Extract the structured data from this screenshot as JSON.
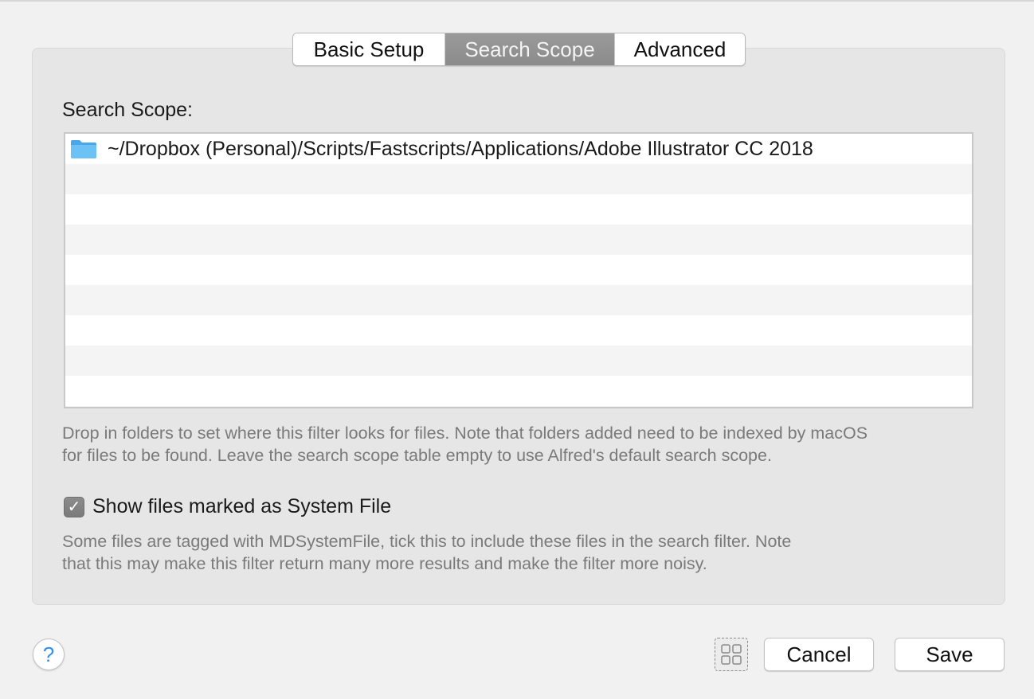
{
  "tabs": [
    {
      "label": "Basic Setup",
      "active": false
    },
    {
      "label": "Search Scope",
      "active": true
    },
    {
      "label": "Advanced",
      "active": false
    }
  ],
  "scope": {
    "label": "Search Scope:",
    "rows": [
      {
        "icon": "folder-icon",
        "path": "~/Dropbox (Personal)/Scripts/Fastscripts/Applications/Adobe Illustrator CC 2018"
      }
    ],
    "help_line1": "Drop in folders to set where this filter looks for files. Note that folders added need to be indexed by macOS",
    "help_line2": "for files to be found. Leave the search scope table empty to use Alfred's default search scope."
  },
  "system_file": {
    "checked": true,
    "check_glyph": "✓",
    "label": "Show files marked as System File",
    "help_line1": "Some files are tagged with MDSystemFile, tick this to include these files in the search filter. Note",
    "help_line2": "that this may make this filter return many more results and make the filter more noisy."
  },
  "footer": {
    "help_glyph": "?",
    "grid_icon": "grid-icon",
    "cancel_label": "Cancel",
    "save_label": "Save"
  },
  "colors": {
    "active_tab": "#8f8f8f",
    "help_accent": "#2f8ef3",
    "folder": "#5cb8f2"
  }
}
